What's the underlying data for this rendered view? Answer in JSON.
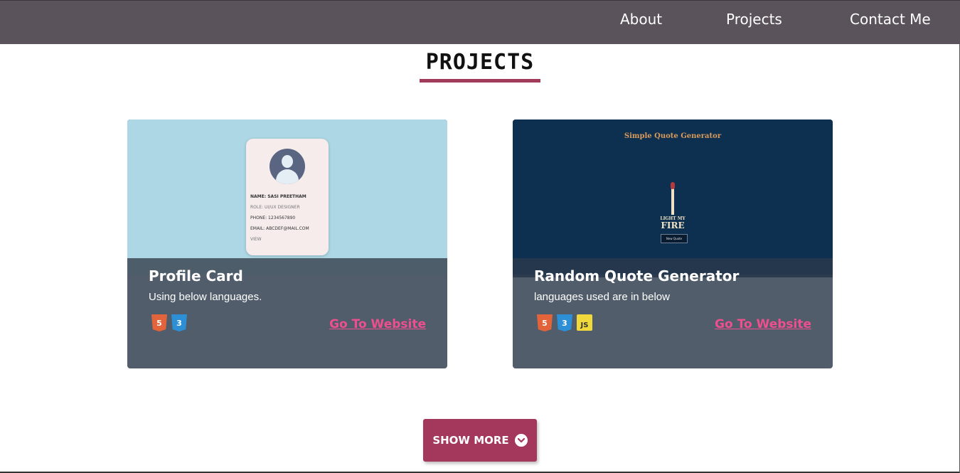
{
  "nav": {
    "links": [
      "About",
      "Projects",
      "Contact Me"
    ]
  },
  "section": {
    "title": "PROJECTS"
  },
  "projects": [
    {
      "title": "Profile Card",
      "description": "Using below languages.",
      "languages": [
        "html5-icon",
        "css3-icon"
      ],
      "link_label": "Go To Website",
      "preview": {
        "lines": [
          "NAME: SASI PREETHAM",
          "ROLE: UI/UX DESIGNER",
          "PHONE: 1234567890",
          "EMAIL: ABCDEF@MAIL.COM",
          "VIEW"
        ]
      }
    },
    {
      "title": "Random Quote Generator",
      "description": "languages used are in below",
      "languages": [
        "html5-icon",
        "css3-icon",
        "javascript-icon"
      ],
      "link_label": "Go To Website",
      "preview": {
        "title": "Simple Quote Generator",
        "quote_small": "LIGHT MY",
        "quote_big": "FIRE",
        "button": "New Quote"
      }
    }
  ],
  "show_more": {
    "label": "SHOW MORE"
  },
  "icons": {
    "html5": "5",
    "css3": "3",
    "js": "JS"
  },
  "colors": {
    "nav_bg": "#5b535b",
    "accent": "#a3385c",
    "link": "#ef4e8f",
    "card_bg": "#515d6a"
  }
}
